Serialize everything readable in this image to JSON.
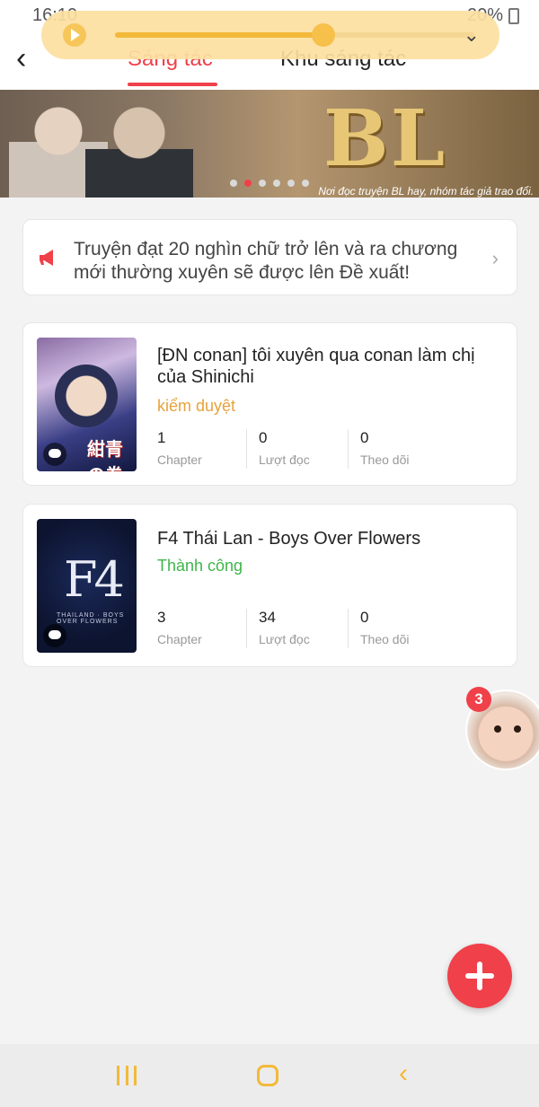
{
  "status_bar": {
    "time": "16:10",
    "battery": "20%"
  },
  "header": {
    "tab_active": "Sáng tác",
    "tab_inactive": "Khu sáng tác"
  },
  "player": {
    "progress": 0.58
  },
  "banner": {
    "logo_text": "BL",
    "caption": "Nơi đọc truyện BL hay, nhóm tác giả trao đổi.",
    "slide_count": 6,
    "active_slide": 1
  },
  "notice": {
    "text": "Truyện đạt 20 nghìn chữ trở lên và ra chương mới thường xuyên sẽ được lên Đề xuất!"
  },
  "stories": [
    {
      "title": "[ĐN conan] tôi xuyên qua conan làm chị của Shinichi",
      "status": "kiểm duyệt",
      "status_color": "#e6a23c",
      "cover_logo": "紺青の拳",
      "stats": [
        {
          "value": "1",
          "label": "Chapter"
        },
        {
          "value": "0",
          "label": "Lượt đọc"
        },
        {
          "value": "0",
          "label": "Theo dõi"
        }
      ]
    },
    {
      "title": "F4 Thái Lan - Boys Over Flowers",
      "status": "Thành công",
      "status_color": "#3fb54a",
      "cover_title": "F4",
      "cover_sub": "THAILAND · BOYS OVER FLOWERS",
      "stats": [
        {
          "value": "3",
          "label": "Chapter"
        },
        {
          "value": "34",
          "label": "Lượt đọc"
        },
        {
          "value": "0",
          "label": "Theo dõi"
        }
      ]
    }
  ],
  "floating_avatar": {
    "badge_count": "3"
  },
  "colors": {
    "accent": "#f0404a",
    "nav_icon": "#f3b93a"
  },
  "icons": [
    "back-arrow-icon",
    "play-icon",
    "chevron-down-icon",
    "megaphone-icon",
    "chevron-right-icon",
    "comment-bubble-icon",
    "plus-icon",
    "recent-apps-icon",
    "home-icon",
    "back-icon"
  ]
}
